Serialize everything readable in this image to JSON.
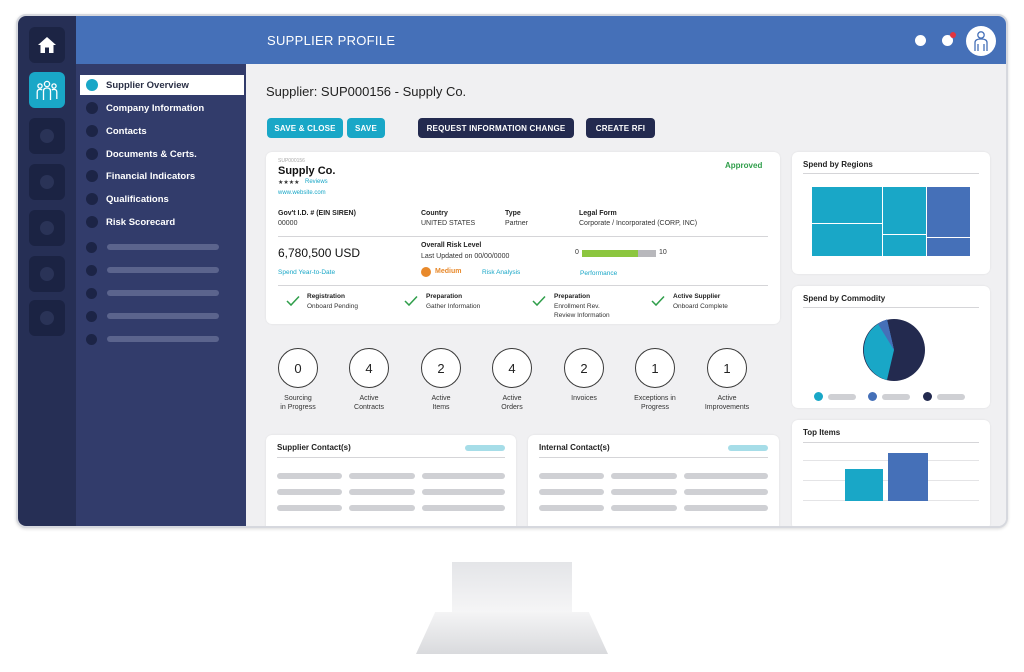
{
  "header": {
    "title": "SUPPLIER PROFILE"
  },
  "nav": {
    "items": [
      {
        "label": "Supplier Overview",
        "selected": true
      },
      {
        "label": "Company Information"
      },
      {
        "label": "Contacts"
      },
      {
        "label": "Documents & Certs."
      },
      {
        "label": "Financial Indicators"
      },
      {
        "label": "Qualifications"
      },
      {
        "label": "Risk Scorecard"
      }
    ]
  },
  "main": {
    "title": "Supplier: SUP000156 - Supply Co.",
    "buttons": {
      "save_close": "SAVE & CLOSE",
      "save": "SAVE",
      "request_change": "REQUEST INFORMATION CHANGE",
      "create_rfi": "CREATE RFI"
    },
    "profile": {
      "id": "SUP000156",
      "name": "Supply Co.",
      "stars": "★★★★",
      "reviews": "Reviews",
      "website": "www.website.com",
      "status": "Approved",
      "govt_id_label": "Gov't I.D. # (EIN SIREN)",
      "govt_id_value": "00000",
      "country_label": "Country",
      "country_value": "UNITED STATES",
      "type_label": "Type",
      "type_value": "Partner",
      "legal_label": "Legal Form",
      "legal_value": "Corporate / Incorporated (CORP, INC)",
      "spend_value": "6,780,500 USD",
      "spend_label": "Spend Year-to-Date",
      "risk_label": "Overall Risk Level",
      "risk_updated": "Last Updated on 00/00/0000",
      "risk_level": "Medium",
      "risk_link": "Risk Analysis",
      "perf_min": "0",
      "perf_max": "10",
      "perf_fill_fraction": 0.75,
      "perf_link": "Performance"
    },
    "stages": [
      {
        "title": "Registration",
        "sub": "Onboard Pending",
        "sub2": ""
      },
      {
        "title": "Preparation",
        "sub": "Gather Information",
        "sub2": ""
      },
      {
        "title": "Preparation",
        "sub": "Enrollment Rev.",
        "sub2": "Review Information"
      },
      {
        "title": "Active Supplier",
        "sub": "Onboard Complete",
        "sub2": ""
      }
    ],
    "counters": [
      {
        "value": "0",
        "line1": "Sourcing",
        "line2": "in Progress"
      },
      {
        "value": "4",
        "line1": "Active",
        "line2": "Contracts"
      },
      {
        "value": "2",
        "line1": "Active",
        "line2": "Items"
      },
      {
        "value": "4",
        "line1": "Active",
        "line2": "Orders"
      },
      {
        "value": "2",
        "line1": "Invoices",
        "line2": ""
      },
      {
        "value": "1",
        "line1": "Exceptions in",
        "line2": "Progress"
      },
      {
        "value": "1",
        "line1": "Active",
        "line2": "Improvements"
      }
    ],
    "supplier_contacts": {
      "title": "Supplier Contact(s)"
    },
    "internal_contacts": {
      "title": "Internal Contact(s)"
    }
  },
  "widgets": {
    "regions": {
      "title": "Spend by Regions"
    },
    "commodity": {
      "title": "Spend by Commodity"
    },
    "top_items": {
      "title": "Top Items"
    }
  },
  "colors": {
    "accent": "#19a7c7",
    "brand_blue": "#4570b8",
    "navy": "#232a4f",
    "approved": "#2f9e4a",
    "medium": "#e8892b",
    "progress": "#8cc63f"
  },
  "icons": {
    "home": "home-icon",
    "team": "team-icon",
    "check": "check-icon",
    "user": "user-avatar-icon"
  }
}
